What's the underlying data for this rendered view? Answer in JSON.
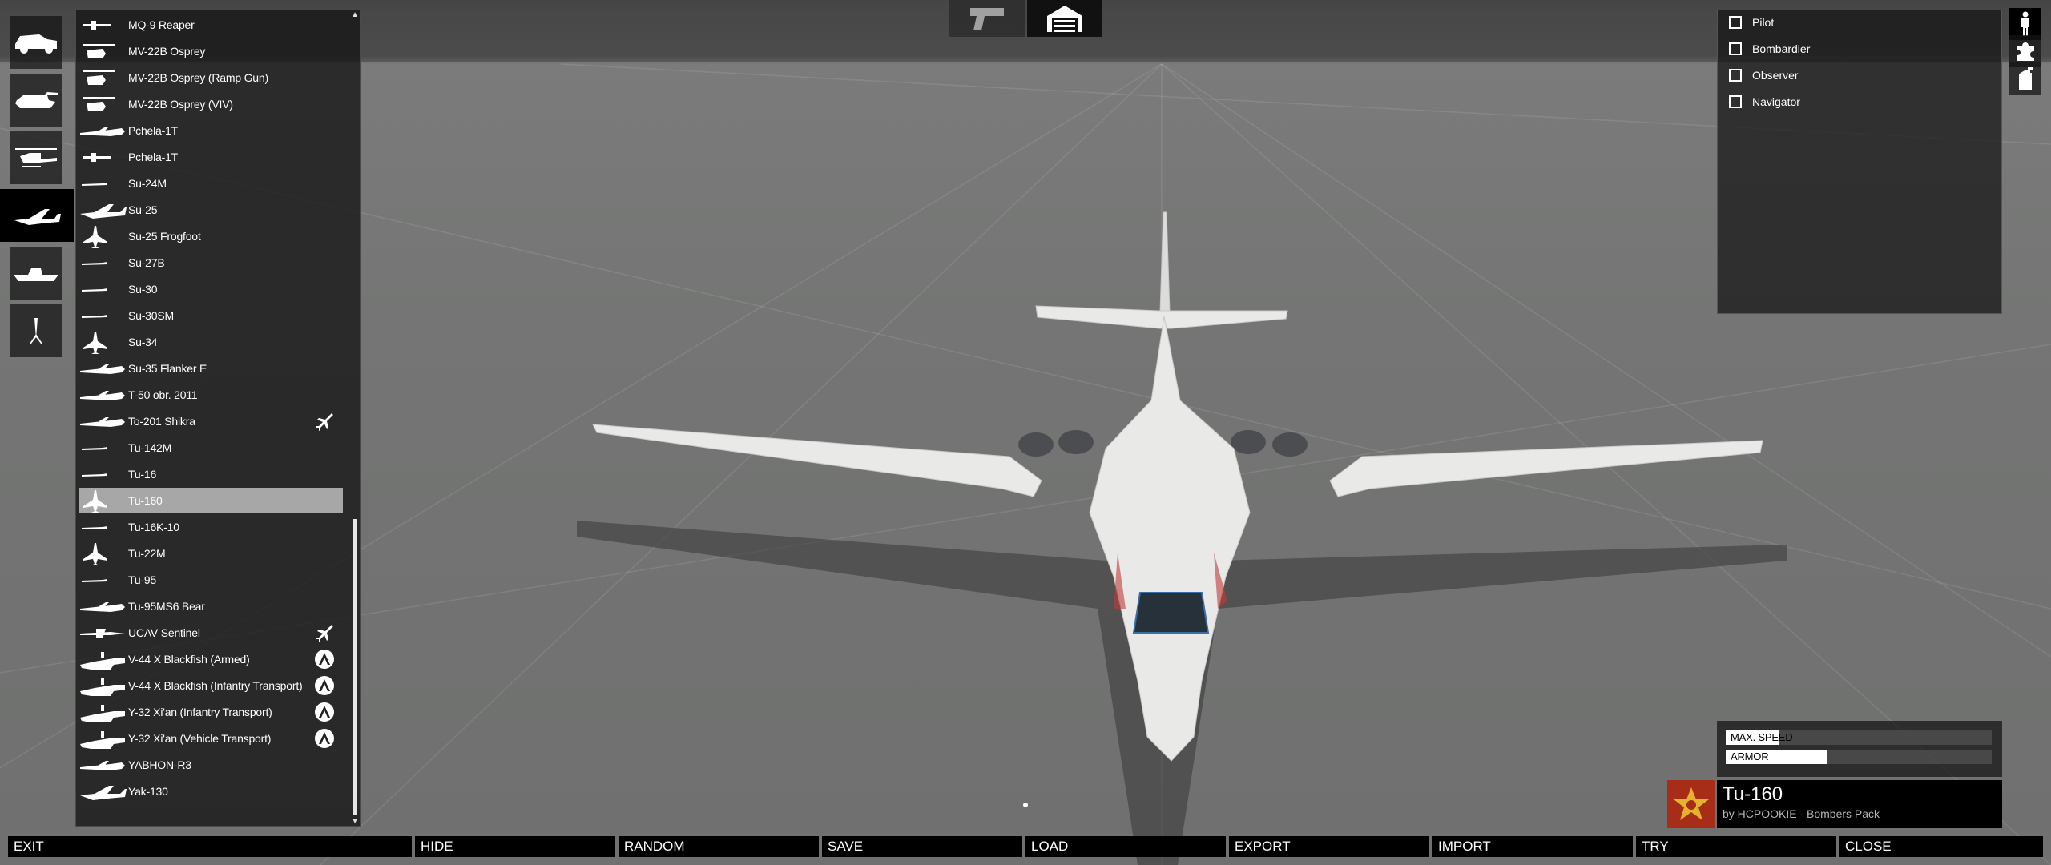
{
  "categories": [
    {
      "name": "car",
      "icon": "car-icon",
      "selected": false
    },
    {
      "name": "tank",
      "icon": "tank-icon",
      "selected": false
    },
    {
      "name": "helicopter",
      "icon": "helicopter-icon",
      "selected": false
    },
    {
      "name": "plane",
      "icon": "plane-icon",
      "selected": true
    },
    {
      "name": "boat",
      "icon": "boat-icon",
      "selected": false
    },
    {
      "name": "static-weapon",
      "icon": "mortar-icon",
      "selected": false
    }
  ],
  "vehicle_list": {
    "items": [
      {
        "label": "MQ-9 Reaper",
        "thumb": "uav"
      },
      {
        "label": "MV-22B Osprey",
        "thumb": "heli"
      },
      {
        "label": "MV-22B Osprey (Ramp Gun)",
        "thumb": "heli"
      },
      {
        "label": "MV-22B Osprey (VIV)",
        "thumb": "heli"
      },
      {
        "label": "Pchela-1T",
        "thumb": "jet"
      },
      {
        "label": "Pchela-1T",
        "thumb": "uav"
      },
      {
        "label": "Su-24M",
        "thumb": "small"
      },
      {
        "label": "Su-25",
        "thumb": "fighter"
      },
      {
        "label": "Su-25 Frogfoot",
        "thumb": "top"
      },
      {
        "label": "Su-27B",
        "thumb": "small"
      },
      {
        "label": "Su-30",
        "thumb": "small"
      },
      {
        "label": "Su-30SM",
        "thumb": "small"
      },
      {
        "label": "Su-34",
        "thumb": "top"
      },
      {
        "label": "Su-35 Flanker E",
        "thumb": "jet"
      },
      {
        "label": "T-50 obr. 2011",
        "thumb": "jet"
      },
      {
        "label": "To-201 Shikra",
        "thumb": "jet",
        "badge": "jet-badge-icon"
      },
      {
        "label": "Tu-142M",
        "thumb": "small"
      },
      {
        "label": "Tu-16",
        "thumb": "small"
      },
      {
        "label": "Tu-160",
        "thumb": "top",
        "selected": true
      },
      {
        "label": "Tu-16K-10",
        "thumb": "small"
      },
      {
        "label": "Tu-22M",
        "thumb": "top"
      },
      {
        "label": "Tu-95",
        "thumb": "small"
      },
      {
        "label": "Tu-95MS6 Bear",
        "thumb": "jet"
      },
      {
        "label": "UCAV Sentinel",
        "thumb": "uavbig",
        "badge": "jet-badge-icon"
      },
      {
        "label": "V-44 X Blackfish (Armed)",
        "thumb": "tilt",
        "badge": "faction-a-badge-icon"
      },
      {
        "label": "V-44 X Blackfish (Infantry Transport)",
        "thumb": "tilt",
        "badge": "faction-a-badge-icon"
      },
      {
        "label": "Y-32 Xi'an (Infantry Transport)",
        "thumb": "tilt",
        "badge": "faction-a-badge-icon"
      },
      {
        "label": "Y-32 Xi'an (Vehicle Transport)",
        "thumb": "tilt",
        "badge": "faction-a-badge-icon"
      },
      {
        "label": "YABHON-R3",
        "thumb": "jet"
      },
      {
        "label": "Yak-130",
        "thumb": "fighter"
      }
    ]
  },
  "top_buttons": [
    {
      "name": "weapons-tab",
      "icon": "pistol-icon"
    },
    {
      "name": "garage-tab",
      "icon": "garage-icon",
      "active": true
    }
  ],
  "crew": {
    "options": [
      {
        "label": "Pilot",
        "checked": false
      },
      {
        "label": "Bombardier",
        "checked": false
      },
      {
        "label": "Observer",
        "checked": false
      },
      {
        "label": "Navigator",
        "checked": false
      }
    ]
  },
  "right_buttons": [
    {
      "name": "crew-button",
      "icon": "person-icon"
    },
    {
      "name": "components-button",
      "icon": "puzzle-icon"
    },
    {
      "name": "pylons-button",
      "icon": "fuel-canister-icon"
    }
  ],
  "stats": [
    {
      "label": "MAX. SPEED",
      "fraction": 0.2
    },
    {
      "label": "ARMOR",
      "fraction": 0.38
    }
  ],
  "vehicle_info": {
    "name": "Tu-160",
    "author": "by HCPOOKIE - Bombers Pack",
    "flag_icon": "soviet-star-icon",
    "flag_color": "#a72d18"
  },
  "bottom_bar": {
    "buttons": [
      "EXIT",
      "HIDE",
      "RANDOM",
      "SAVE",
      "LOAD",
      "EXPORT",
      "IMPORT",
      "TRY",
      "CLOSE"
    ]
  }
}
